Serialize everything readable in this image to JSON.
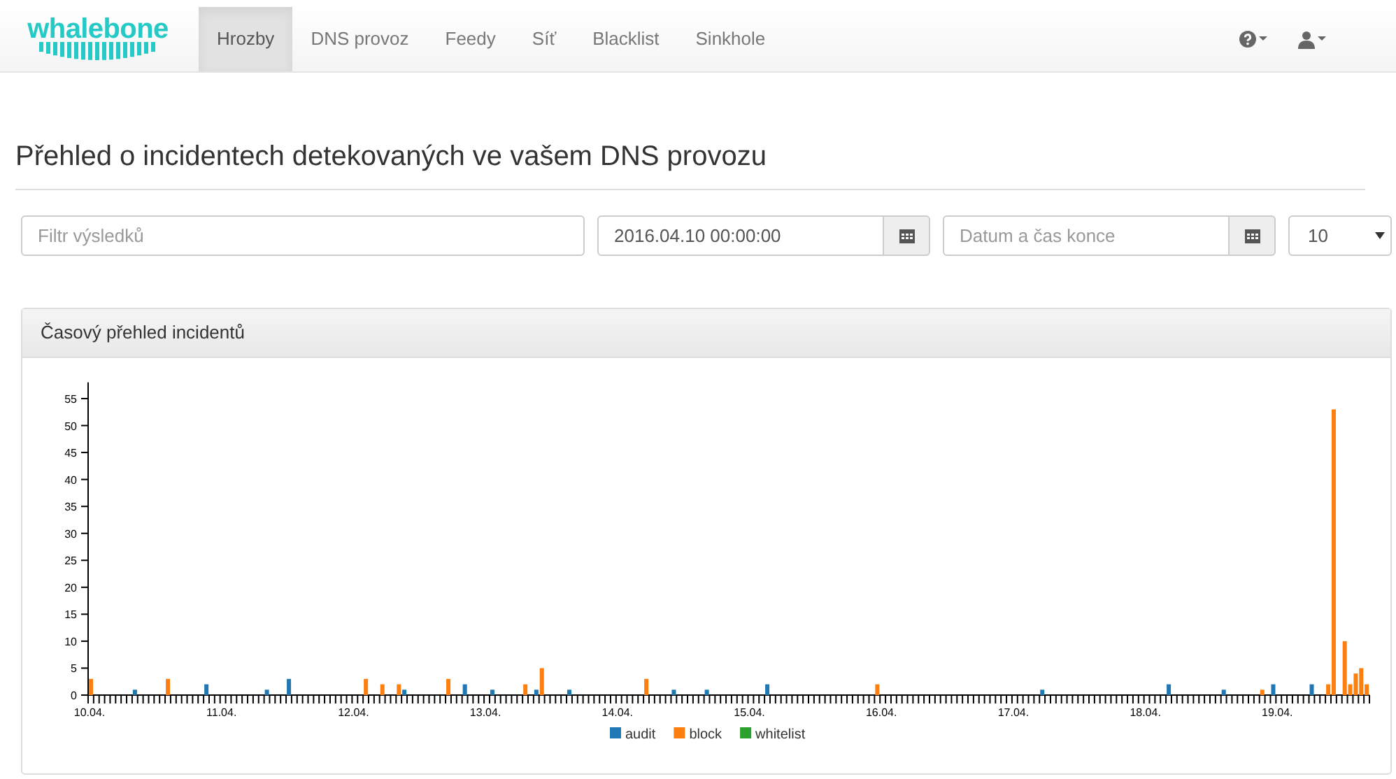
{
  "navbar": {
    "brand": "whalebone",
    "items": [
      {
        "label": "Hrozby",
        "selected": true
      },
      {
        "label": "DNS provoz",
        "selected": false
      },
      {
        "label": "Feedy",
        "selected": false
      },
      {
        "label": "Síť",
        "selected": false
      },
      {
        "label": "Blacklist",
        "selected": false
      },
      {
        "label": "Sinkhole",
        "selected": false
      }
    ]
  },
  "page_title": "Přehled o incidentech detekovaných ve vašem DNS provozu",
  "filters": {
    "search": {
      "placeholder": "Filtr výsledků"
    },
    "start": {
      "value": "2016.04.10 00:00:00"
    },
    "end": {
      "placeholder": "Datum a čas konce"
    },
    "page_size": {
      "value": "10"
    }
  },
  "panel": {
    "title": "Časový přehled incidentů",
    "chart_data": {
      "type": "bar",
      "categories": [
        "10.04.",
        null,
        null,
        null,
        null,
        null,
        null,
        null,
        null,
        null,
        null,
        null,
        null,
        null,
        null,
        null,
        null,
        null,
        null,
        null,
        null,
        null,
        null,
        null,
        "11.04.",
        null,
        null,
        null,
        null,
        null,
        null,
        null,
        null,
        null,
        null,
        null,
        null,
        null,
        null,
        null,
        null,
        null,
        null,
        null,
        null,
        null,
        null,
        null,
        "12.04.",
        null,
        null,
        null,
        null,
        null,
        null,
        null,
        null,
        null,
        null,
        null,
        null,
        null,
        null,
        null,
        null,
        null,
        null,
        null,
        null,
        null,
        null,
        null,
        "13.04.",
        null,
        null,
        null,
        null,
        null,
        null,
        null,
        null,
        null,
        null,
        null,
        null,
        null,
        null,
        null,
        null,
        null,
        null,
        null,
        null,
        null,
        null,
        null,
        "14.04.",
        null,
        null,
        null,
        null,
        null,
        null,
        null,
        null,
        null,
        null,
        null,
        null,
        null,
        null,
        null,
        null,
        null,
        null,
        null,
        null,
        null,
        null,
        null,
        "15.04.",
        null,
        null,
        null,
        null,
        null,
        null,
        null,
        null,
        null,
        null,
        null,
        null,
        null,
        null,
        null,
        null,
        null,
        null,
        null,
        null,
        null,
        null,
        null,
        "16.04.",
        null,
        null,
        null,
        null,
        null,
        null,
        null,
        null,
        null,
        null,
        null,
        null,
        null,
        null,
        null,
        null,
        null,
        null,
        null,
        null,
        null,
        null,
        null,
        "17.04.",
        null,
        null,
        null,
        null,
        null,
        null,
        null,
        null,
        null,
        null,
        null,
        null,
        null,
        null,
        null,
        null,
        null,
        null,
        null,
        null,
        null,
        null,
        null,
        "18.04.",
        null,
        null,
        null,
        null,
        null,
        null,
        null,
        null,
        null,
        null,
        null,
        null,
        null,
        null,
        null,
        null,
        null,
        null,
        null,
        null,
        null,
        null,
        null,
        "19.04.",
        null,
        null,
        null,
        null,
        null,
        null,
        null,
        null,
        null,
        null,
        null,
        null,
        null,
        null,
        null,
        null,
        null
      ],
      "series": [
        {
          "name": "audit",
          "color": "#1f77b4",
          "values": [
            null,
            null,
            null,
            null,
            null,
            null,
            null,
            null,
            1,
            null,
            null,
            null,
            null,
            null,
            null,
            null,
            null,
            null,
            null,
            null,
            null,
            2,
            null,
            null,
            null,
            null,
            null,
            null,
            null,
            null,
            null,
            null,
            1,
            null,
            null,
            null,
            3,
            null,
            null,
            null,
            null,
            null,
            null,
            null,
            null,
            null,
            null,
            null,
            null,
            null,
            null,
            null,
            null,
            null,
            null,
            null,
            null,
            1,
            null,
            null,
            null,
            null,
            null,
            null,
            null,
            null,
            null,
            null,
            2,
            null,
            null,
            null,
            null,
            1,
            null,
            null,
            null,
            null,
            null,
            null,
            null,
            1,
            null,
            null,
            null,
            null,
            null,
            1,
            null,
            null,
            null,
            null,
            null,
            null,
            null,
            null,
            null,
            null,
            null,
            null,
            null,
            null,
            null,
            null,
            null,
            null,
            1,
            null,
            null,
            null,
            null,
            null,
            1,
            null,
            null,
            null,
            null,
            null,
            null,
            null,
            null,
            null,
            null,
            2,
            null,
            null,
            null,
            null,
            null,
            null,
            null,
            null,
            null,
            null,
            null,
            null,
            null,
            null,
            null,
            null,
            null,
            null,
            null,
            null,
            null,
            null,
            null,
            null,
            null,
            null,
            null,
            null,
            null,
            null,
            null,
            null,
            null,
            null,
            null,
            null,
            null,
            null,
            null,
            null,
            null,
            null,
            null,
            null,
            null,
            null,
            null,
            null,
            null,
            1,
            null,
            null,
            null,
            null,
            null,
            null,
            null,
            null,
            null,
            null,
            null,
            null,
            null,
            null,
            null,
            null,
            null,
            null,
            null,
            null,
            null,
            null,
            2,
            null,
            null,
            null,
            null,
            null,
            null,
            null,
            null,
            null,
            1,
            null,
            null,
            null,
            null,
            null,
            null,
            null,
            null,
            2,
            null,
            null,
            null,
            null,
            null,
            null,
            2,
            null,
            null,
            null,
            null,
            null,
            null,
            null,
            null,
            null,
            null,
            null
          ]
        },
        {
          "name": "block",
          "color": "#ff7f0e",
          "values": [
            3,
            null,
            null,
            null,
            null,
            null,
            null,
            null,
            null,
            null,
            null,
            null,
            null,
            null,
            3,
            null,
            null,
            null,
            null,
            null,
            null,
            null,
            null,
            null,
            null,
            null,
            null,
            null,
            null,
            null,
            null,
            null,
            null,
            null,
            null,
            null,
            null,
            null,
            null,
            null,
            null,
            null,
            null,
            null,
            null,
            null,
            null,
            null,
            null,
            null,
            3,
            null,
            null,
            2,
            null,
            null,
            2,
            null,
            null,
            null,
            null,
            null,
            null,
            null,
            null,
            3,
            null,
            null,
            null,
            null,
            null,
            null,
            null,
            null,
            null,
            null,
            null,
            null,
            null,
            2,
            null,
            null,
            5,
            null,
            null,
            null,
            null,
            null,
            null,
            null,
            null,
            null,
            null,
            null,
            null,
            null,
            null,
            null,
            null,
            null,
            null,
            3,
            null,
            null,
            null,
            null,
            null,
            null,
            null,
            null,
            null,
            null,
            null,
            null,
            null,
            null,
            null,
            null,
            null,
            null,
            null,
            null,
            null,
            null,
            null,
            null,
            null,
            null,
            null,
            null,
            null,
            null,
            null,
            null,
            null,
            null,
            null,
            null,
            null,
            null,
            null,
            null,
            null,
            2,
            null,
            null,
            null,
            null,
            null,
            null,
            null,
            null,
            null,
            null,
            null,
            null,
            null,
            null,
            null,
            null,
            null,
            null,
            null,
            null,
            null,
            null,
            null,
            null,
            null,
            null,
            null,
            null,
            null,
            null,
            null,
            null,
            null,
            null,
            null,
            null,
            null,
            null,
            null,
            null,
            null,
            null,
            null,
            null,
            null,
            null,
            null,
            null,
            null,
            null,
            null,
            null,
            null,
            null,
            null,
            null,
            null,
            null,
            null,
            null,
            null,
            null,
            null,
            null,
            null,
            null,
            null,
            null,
            null,
            1,
            null,
            null,
            null,
            null,
            null,
            null,
            null,
            null,
            null,
            null,
            null,
            2,
            53,
            null,
            10,
            2,
            4,
            5,
            2,
            null
          ]
        },
        {
          "name": "whitelist",
          "color": "#2ca02c",
          "values": [
            null,
            null,
            null,
            null,
            null,
            null,
            null,
            null,
            null,
            null,
            null,
            null,
            null,
            null,
            null,
            null,
            null,
            null,
            null,
            null,
            null,
            null,
            null,
            null,
            null,
            null,
            null,
            null,
            null,
            null,
            null,
            null,
            null,
            null,
            null,
            null,
            null,
            null,
            null,
            null,
            null,
            null,
            null,
            null,
            null,
            null,
            null,
            null,
            null,
            null,
            null,
            null,
            null,
            null,
            null,
            null,
            null,
            null,
            null,
            null,
            null,
            null,
            null,
            null,
            null,
            null,
            null,
            null,
            null,
            null,
            null,
            null,
            null,
            null,
            null,
            null,
            null,
            null,
            null,
            null,
            null,
            null,
            null,
            null,
            null,
            null,
            null,
            null,
            null,
            null,
            null,
            null,
            null,
            null,
            null,
            null,
            null,
            null,
            null,
            null,
            null,
            null,
            null,
            null,
            null,
            null,
            null,
            null,
            null,
            null,
            null,
            null,
            null,
            null,
            null,
            null,
            null,
            null,
            null,
            null,
            null,
            null,
            null,
            null,
            null,
            null,
            null,
            null,
            null,
            null,
            null,
            null,
            null,
            null,
            null,
            null,
            null,
            null,
            null,
            null,
            null,
            null,
            null,
            null,
            null,
            null,
            null,
            null,
            null,
            null,
            null,
            null,
            null,
            null,
            null,
            null,
            null,
            null,
            null,
            null,
            null,
            null,
            null,
            null,
            null,
            null,
            null,
            null,
            null,
            null,
            null,
            null,
            null,
            null,
            null,
            null,
            null,
            null,
            null,
            null,
            null,
            null,
            null,
            null,
            null,
            null,
            null,
            null,
            null,
            null,
            null,
            null,
            null,
            null,
            null,
            null,
            null,
            null,
            null,
            null,
            null,
            null,
            null,
            null,
            null,
            null,
            null,
            null,
            null,
            null,
            null,
            null,
            null,
            null,
            null,
            null,
            null,
            null,
            null,
            null,
            null,
            null,
            null,
            null,
            null,
            null,
            null,
            null,
            null,
            null,
            null,
            null,
            null,
            null
          ]
        }
      ],
      "legend": "bottom",
      "ylim": [
        0,
        58
      ],
      "yticks": [
        0,
        5,
        10,
        15,
        20,
        25,
        30,
        35,
        40,
        45,
        50,
        55
      ]
    }
  }
}
